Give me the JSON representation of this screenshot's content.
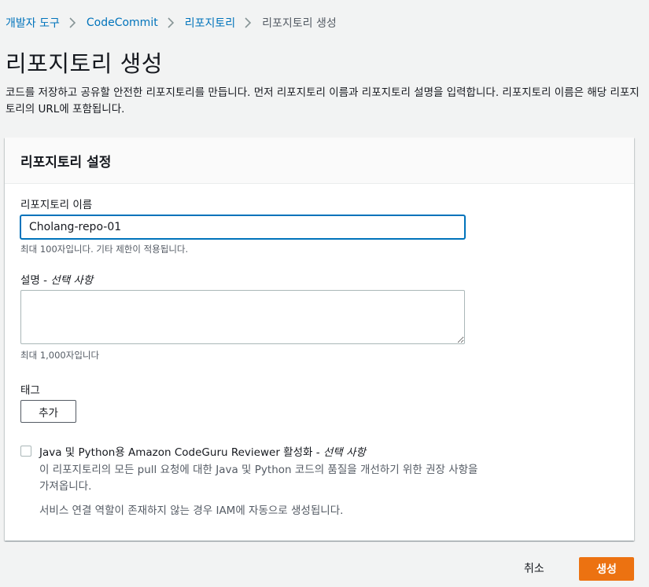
{
  "breadcrumb": {
    "items": [
      {
        "label": "개발자 도구"
      },
      {
        "label": "CodeCommit"
      },
      {
        "label": "리포지토리"
      },
      {
        "label": "리포지토리 생성"
      }
    ]
  },
  "page": {
    "title": "리포지토리 생성",
    "description": "코드를 저장하고 공유할 안전한 리포지토리를 만듭니다. 먼저 리포지토리 이름과 리포지토리 설명을 입력합니다. 리포지토리 이름은 해당 리포지토리의 URL에 포함됩니다."
  },
  "settings": {
    "title": "리포지토리 설정",
    "name_label": "리포지토리 이름",
    "name_value": "Cholang-repo-01",
    "name_hint": "최대 100자입니다. 기타 제한이 적용됩니다.",
    "desc_label": "설명 - ",
    "desc_optional": "선택 사항",
    "desc_value": "",
    "desc_hint": "최대 1,000자입니다",
    "tags_label": "태그",
    "add_button": "추가",
    "codeguru_label": "Java 및 Python용 Amazon CodeGuru Reviewer 활성화 - ",
    "codeguru_optional": "선택 사항",
    "codeguru_checked": false,
    "codeguru_desc": "이 리포지토리의 모든 pull 요청에 대한 Java 및 Python 코드의 품질을 개선하기 위한 권장 사항을 가져옵니다.",
    "codeguru_note": "서비스 연결 역할이 존재하지 않는 경우 IAM에 자동으로 생성됩니다."
  },
  "actions": {
    "cancel": "취소",
    "create": "생성"
  },
  "colors": {
    "link": "#0073bb",
    "primary": "#ec7211",
    "background": "#f2f3f3"
  }
}
